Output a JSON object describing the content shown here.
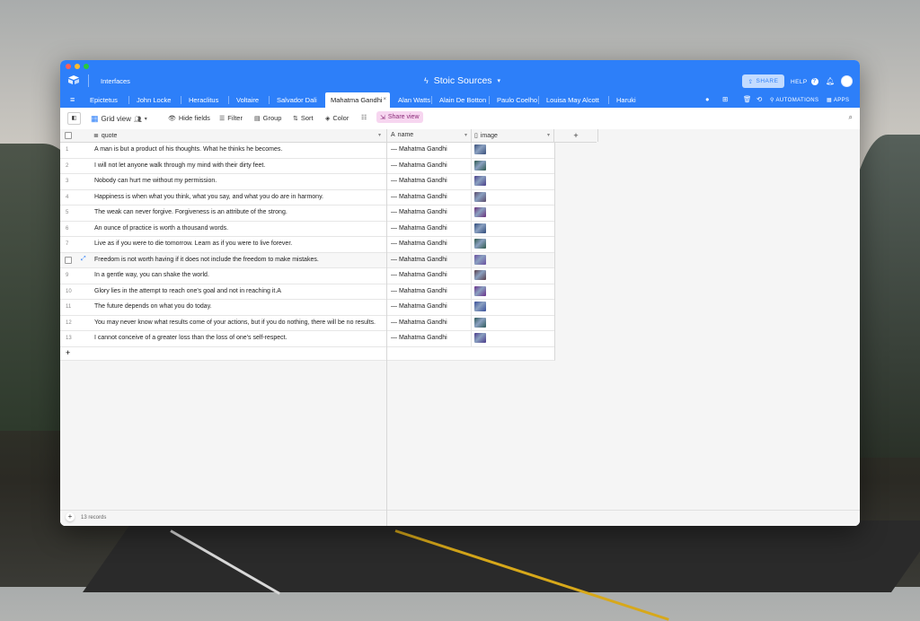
{
  "app": {
    "interfaces_label": "Interfaces",
    "base_title": "Stoic Sources",
    "title_icon": "bolt-icon",
    "share_label": "SHARE",
    "help_label": "HELP",
    "automations_label": "AUTOMATIONS",
    "apps_label": "APPS",
    "brand_color": "#2d7ff9"
  },
  "tabs": [
    {
      "label": "Epictetus",
      "active": false
    },
    {
      "label": "John Locke",
      "active": false
    },
    {
      "label": "Heraclitus",
      "active": false
    },
    {
      "label": "Voltaire",
      "active": false
    },
    {
      "label": "Salvador Dali",
      "active": false
    },
    {
      "label": "Mahatma Gandhi",
      "active": true
    },
    {
      "label": "Alan Watts",
      "active": false
    },
    {
      "label": "Alain De Botton",
      "active": false
    },
    {
      "label": "Paulo Coelho",
      "active": false
    },
    {
      "label": "Louisa May Alcott",
      "active": false
    },
    {
      "label": "Haruki Murakami",
      "active": false
    }
  ],
  "toolbar": {
    "grid_view": "Grid view",
    "hide_fields": "Hide fields",
    "filter": "Filter",
    "group": "Group",
    "sort": "Sort",
    "color": "Color",
    "share_view": "Share view"
  },
  "columns": {
    "quote": "quote",
    "name": "name",
    "image": "image"
  },
  "records": [
    {
      "quote": "A man is but a product of his thoughts. What he thinks he becomes.",
      "name": "— Mahatma Gandhi"
    },
    {
      "quote": "I will not let anyone walk through my mind with their dirty feet.",
      "name": "— Mahatma Gandhi"
    },
    {
      "quote": "Nobody can hurt me without my permission.",
      "name": "— Mahatma Gandhi"
    },
    {
      "quote": "Happiness is when what you think, what you say, and what you do are in harmony.",
      "name": "— Mahatma Gandhi"
    },
    {
      "quote": "The weak can never forgive. Forgiveness is an attribute of the strong.",
      "name": "— Mahatma Gandhi"
    },
    {
      "quote": "An ounce of practice is worth a thousand words.",
      "name": "— Mahatma Gandhi"
    },
    {
      "quote": "Live as if you were to die tomorrow. Learn as if you were to live forever.",
      "name": "— Mahatma Gandhi"
    },
    {
      "quote": "Freedom is not worth having if it does not include the freedom to make mistakes.",
      "name": "— Mahatma Gandhi"
    },
    {
      "quote": "In a gentle way, you can shake the world.",
      "name": "— Mahatma Gandhi"
    },
    {
      "quote": "Glory lies in the attempt to reach one's goal and not in reaching it.A",
      "name": "— Mahatma Gandhi"
    },
    {
      "quote": "The future depends on what you do today.",
      "name": "— Mahatma Gandhi"
    },
    {
      "quote": "You may never know what results come of your actions, but if you do nothing, there will be no results.",
      "name": "— Mahatma Gandhi"
    },
    {
      "quote": "I cannot conceive of a greater loss than the loss of one's self-respect.",
      "name": "— Mahatma Gandhi"
    }
  ],
  "row_numbers": [
    "1",
    "2",
    "3",
    "4",
    "5",
    "6",
    "7",
    "",
    "9",
    "10",
    "11",
    "12",
    "13"
  ],
  "thumb_colors": [
    "#3a4f7a",
    "#2e5a4f",
    "#4a3f8a",
    "#5a4a6a",
    "#6a2f7a",
    "#2f4a7a",
    "#2f5a4a",
    "#6a4fa0",
    "#5a3f4a",
    "#6a2f8a",
    "#3a4f9a",
    "#2f5a5a",
    "#4a3a8a"
  ],
  "footer": {
    "record_count": "13 records"
  }
}
